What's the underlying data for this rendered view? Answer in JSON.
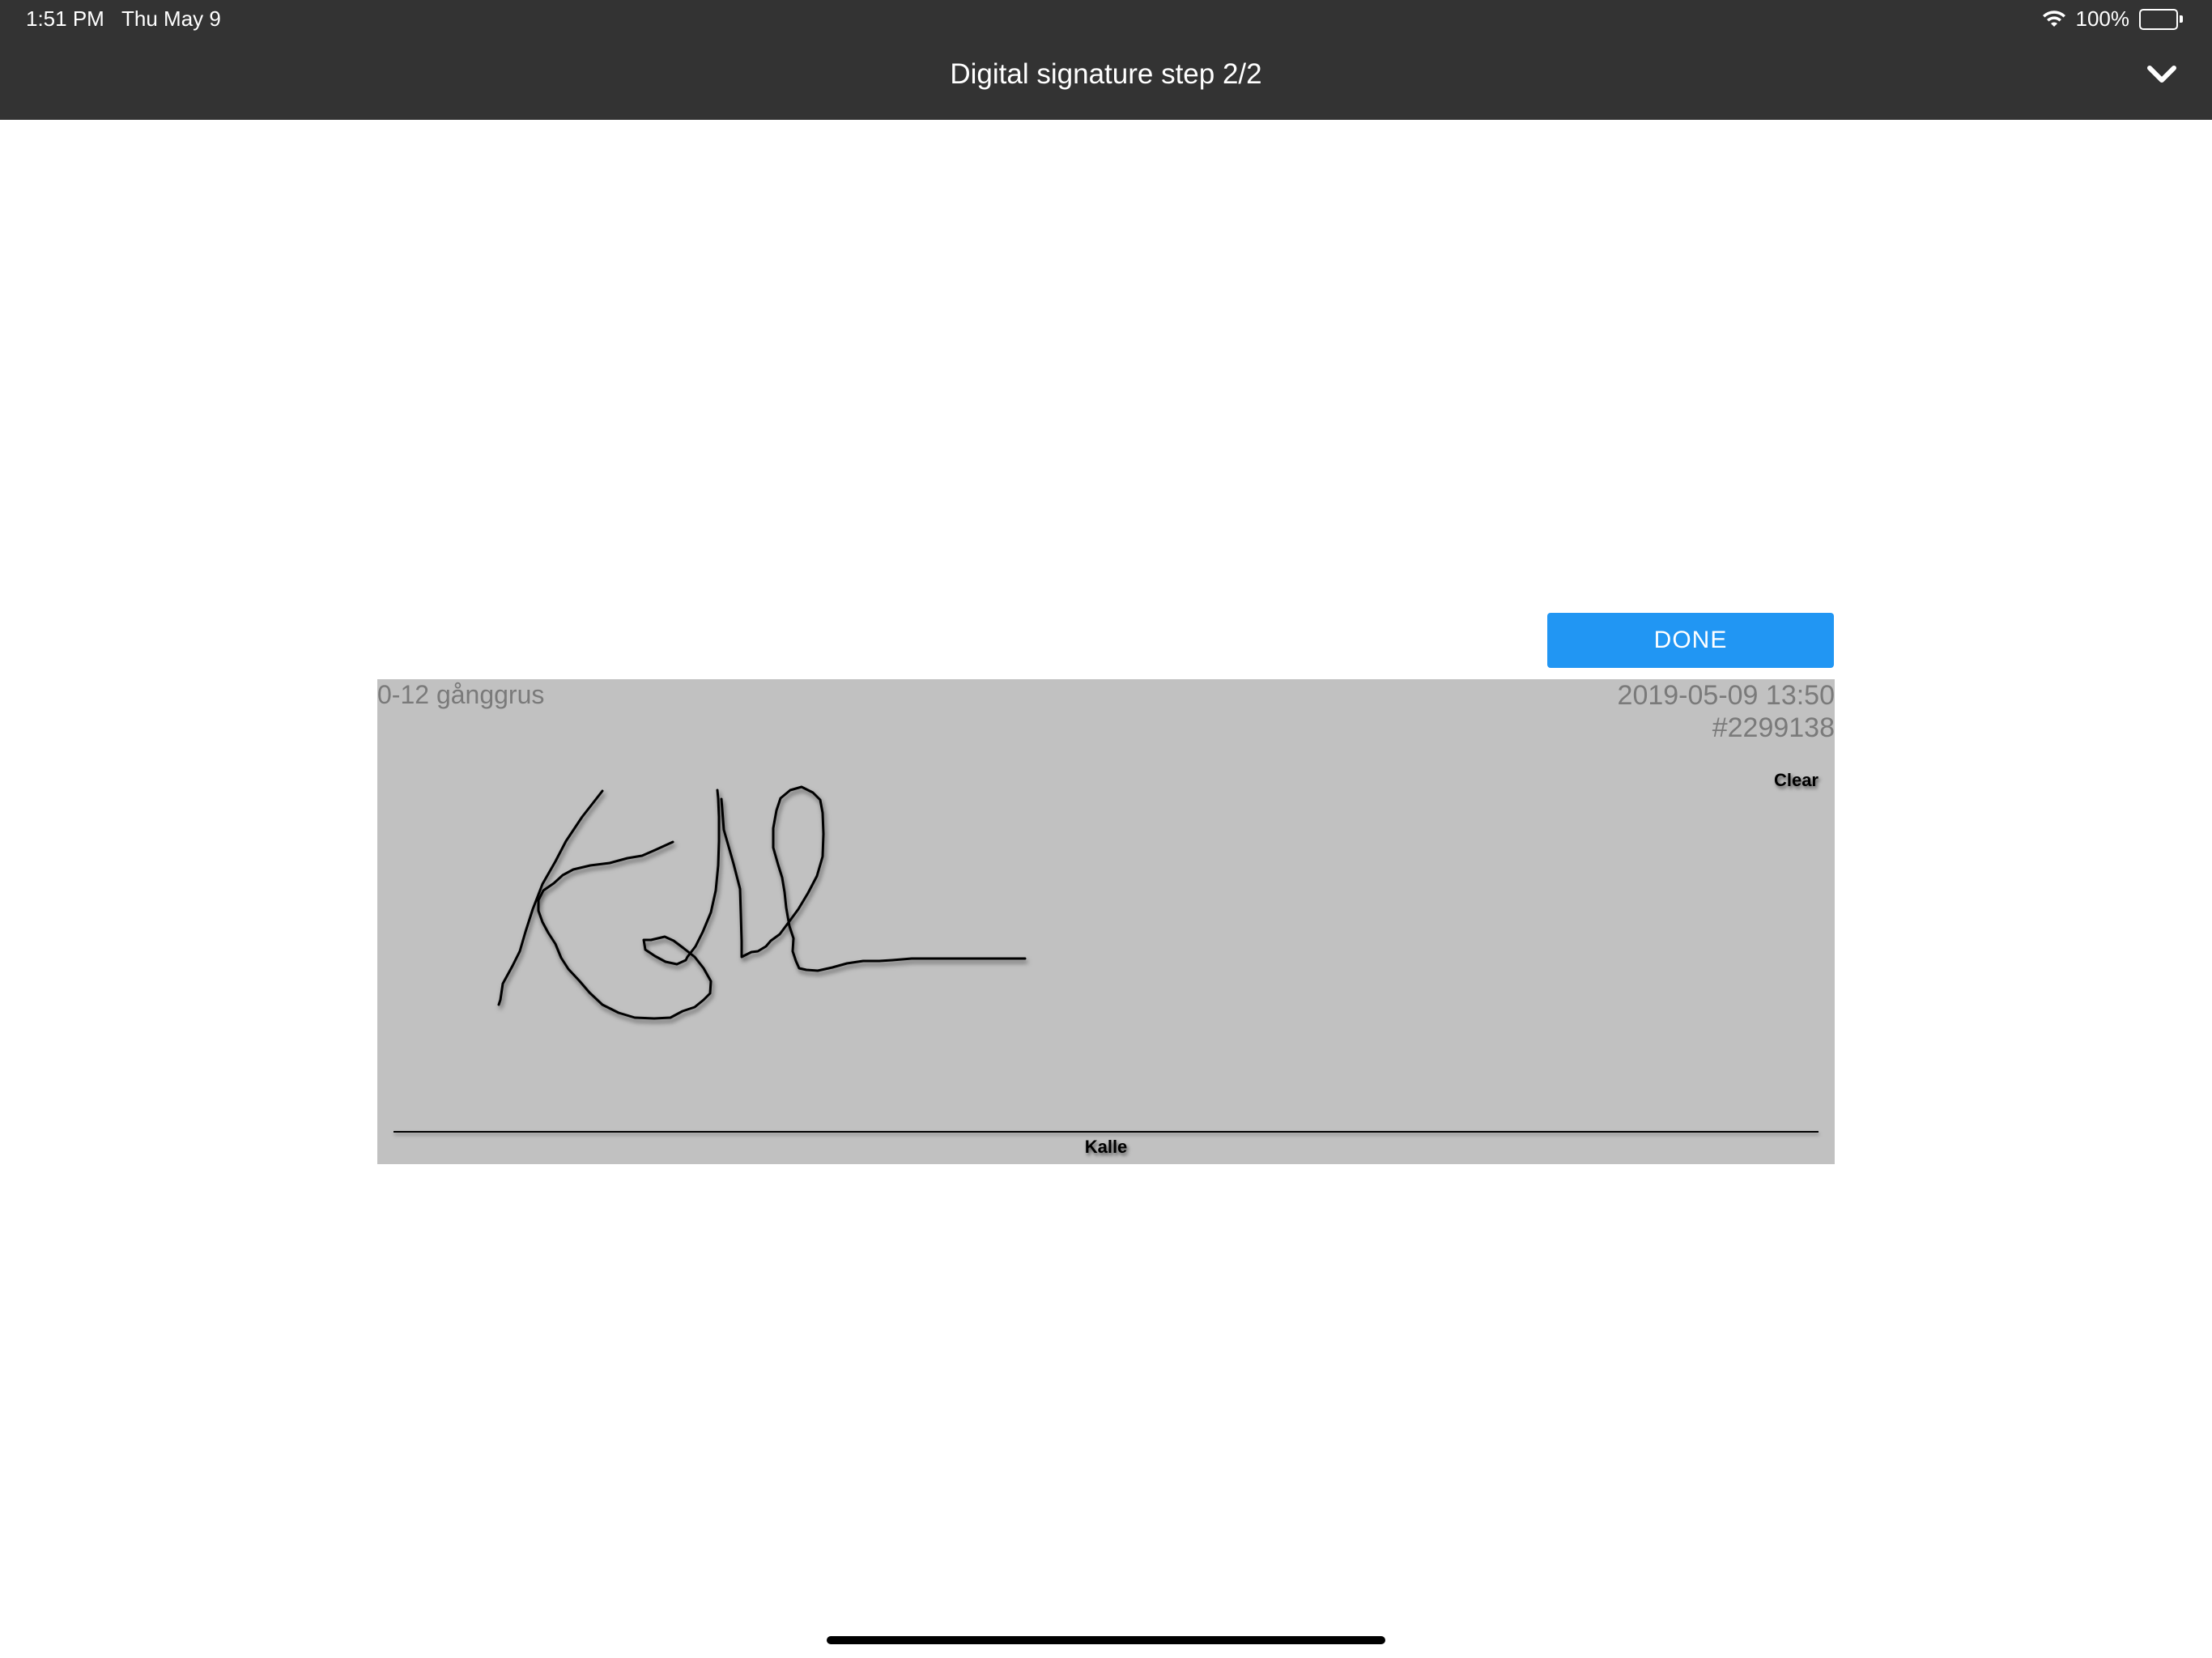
{
  "status_bar": {
    "time": "1:51 PM",
    "date": "Thu May 9",
    "battery": "100%",
    "battery_level": 1.0
  },
  "nav": {
    "title": "Digital signature step 2/2",
    "collapse_icon": "chevron-down-icon"
  },
  "actions": {
    "done_label": "DONE",
    "clear_label": "Clear"
  },
  "signature": {
    "product": "0-12 gånggrus",
    "datetime": "2019-05-09 13:50",
    "order_number": "#2299138",
    "signer_name": "Kalle"
  },
  "colors": {
    "topbar": "#333333",
    "accent": "#2196f3",
    "signature_panel": "#c1c1c1"
  }
}
